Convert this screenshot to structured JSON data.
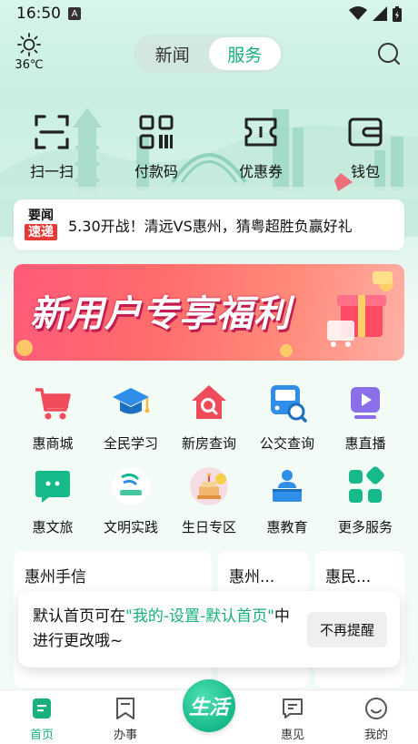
{
  "status_bar": {
    "time": "16:50",
    "notif_badge": "A"
  },
  "header": {
    "weather": {
      "temp": "36℃"
    },
    "tabs": [
      {
        "label": "新闻",
        "active": false
      },
      {
        "label": "服务",
        "active": true
      }
    ]
  },
  "quick_actions": [
    {
      "label": "扫一扫",
      "icon": "scan-icon"
    },
    {
      "label": "付款码",
      "icon": "payment-code-icon"
    },
    {
      "label": "优惠券",
      "icon": "coupon-icon"
    },
    {
      "label": "钱包",
      "icon": "wallet-icon"
    }
  ],
  "news": {
    "badge_top": "要闻",
    "badge_bottom": "速递",
    "text": "5.30开战！清远VS惠州，猜粤超胜负赢好礼"
  },
  "banner": {
    "title": "新用户专享福利"
  },
  "services": [
    {
      "label": "惠商城",
      "icon": "cart-icon"
    },
    {
      "label": "全民学习",
      "icon": "graduation-cap-icon"
    },
    {
      "label": "新房查询",
      "icon": "house-search-icon"
    },
    {
      "label": "公交查询",
      "icon": "bus-search-icon"
    },
    {
      "label": "惠直播",
      "icon": "live-play-icon"
    },
    {
      "label": "惠文旅",
      "icon": "chat-travel-icon"
    },
    {
      "label": "文明实践",
      "icon": "civilization-logo-icon"
    },
    {
      "label": "生日专区",
      "icon": "birthday-cake-icon"
    },
    {
      "label": "惠教育",
      "icon": "teacher-podium-icon"
    },
    {
      "label": "更多服务",
      "icon": "more-grid-icon"
    }
  ],
  "cards": [
    {
      "title": "惠州手信"
    },
    {
      "title": "惠州..."
    },
    {
      "title": "惠民..."
    }
  ],
  "toast": {
    "msg_pre": "默认首页可在",
    "msg_highlight": "\"我的-设置-默认首页\"",
    "msg_post": "中进行更改哦~",
    "button": "不再提醒"
  },
  "bottom_nav": [
    {
      "label": "首页",
      "active": true,
      "icon": "home-icon"
    },
    {
      "label": "办事",
      "active": false,
      "icon": "affairs-icon"
    },
    {
      "label": "生活",
      "active": false,
      "icon": "life-center-icon"
    },
    {
      "label": "惠见",
      "active": false,
      "icon": "message-icon"
    },
    {
      "label": "我的",
      "active": false,
      "icon": "profile-icon"
    }
  ],
  "colors": {
    "accent": "#19b07b",
    "news_badge": "#e53935",
    "icon_green": "#16b98a",
    "icon_red": "#ef4b5a",
    "icon_blue": "#2f8fe8"
  }
}
